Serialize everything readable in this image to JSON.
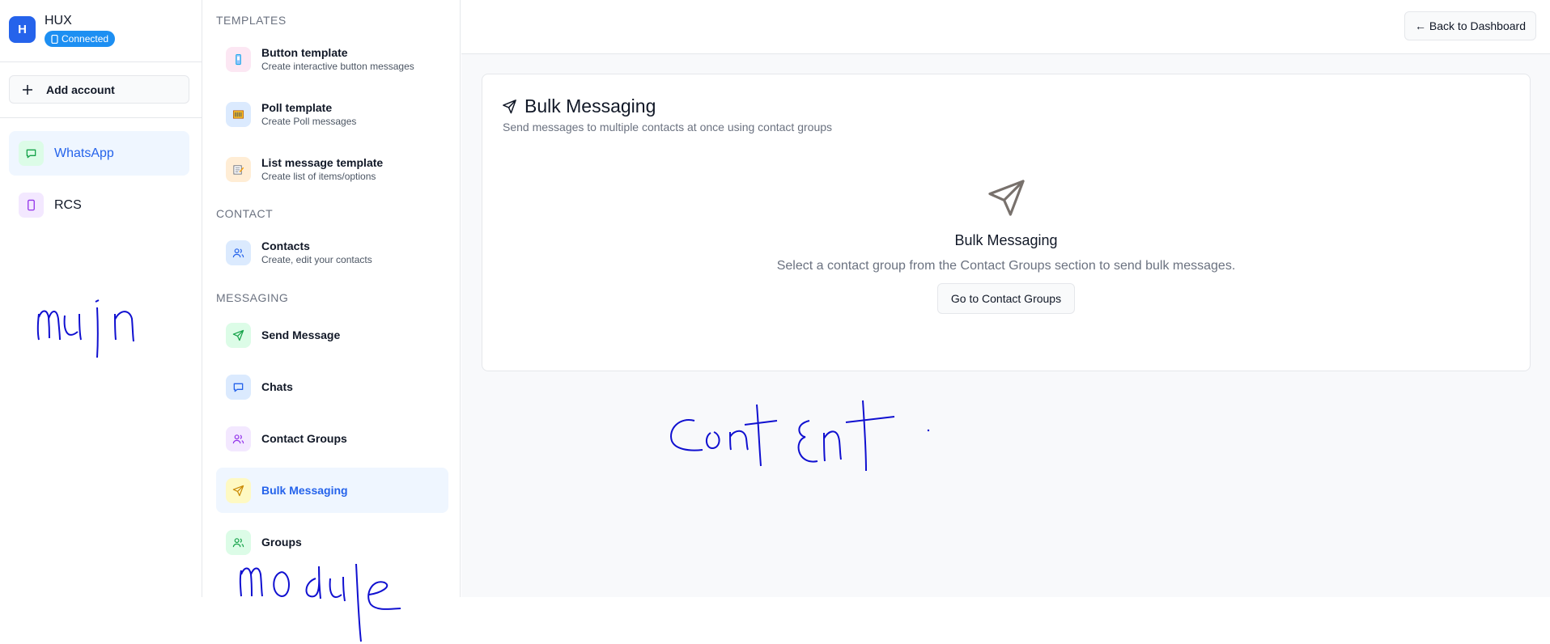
{
  "account": {
    "avatar_letter": "H",
    "name": "HUX",
    "status": "Connected"
  },
  "sidebar": {
    "add_account_label": "Add account",
    "channels": [
      {
        "label": "WhatsApp",
        "icon": "chat-bubble-icon",
        "active": true,
        "color": "#16a34a",
        "bg": "#dcfce7"
      },
      {
        "label": "RCS",
        "icon": "phone-icon",
        "active": false,
        "color": "#9333ea",
        "bg": "#f3e8ff"
      }
    ]
  },
  "module": {
    "sections": {
      "templates": "TEMPLATES",
      "contact": "CONTACT",
      "messaging": "MESSAGING"
    },
    "templates": [
      {
        "title": "Button template",
        "subtitle": "Create interactive button messages",
        "icon": "phone-button-icon",
        "bg": "#fce7f3"
      },
      {
        "title": "Poll template",
        "subtitle": "Create Poll messages",
        "icon": "poll-icon",
        "bg": "#dbeafe"
      },
      {
        "title": "List message template",
        "subtitle": "Create list of items/options",
        "icon": "memo-icon",
        "bg": "#ffedd5"
      }
    ],
    "contact": [
      {
        "title": "Contacts",
        "subtitle": "Create, edit your contacts",
        "icon": "users-icon",
        "bg": "#dbeafe"
      }
    ],
    "messaging": [
      {
        "label": "Send Message",
        "icon": "send-icon",
        "color": "#16a34a",
        "bg": "#dcfce7"
      },
      {
        "label": "Chats",
        "icon": "chat-bubble-icon",
        "color": "#2563eb",
        "bg": "#dbeafe"
      },
      {
        "label": "Contact Groups",
        "icon": "users-icon",
        "color": "#9333ea",
        "bg": "#f3e8ff"
      },
      {
        "label": "Bulk Messaging",
        "icon": "send-icon",
        "color": "#ca8a04",
        "bg": "#fef9c3",
        "active": true
      },
      {
        "label": "Groups",
        "icon": "users-icon",
        "color": "#16a34a",
        "bg": "#dcfce7"
      }
    ]
  },
  "main": {
    "back_label": "← Back to Dashboard",
    "card_title": "Bulk Messaging",
    "card_subtitle": "Send messages to multiple contacts at once using contact groups",
    "empty_title": "Bulk Messaging",
    "empty_desc": "Select a contact group from the Contact Groups section to send bulk messages.",
    "go_button": "Go to Contact Groups"
  },
  "colors": {
    "accent": "#2563eb",
    "badge": "#1d8ff2",
    "annotation": "#1010d0"
  }
}
